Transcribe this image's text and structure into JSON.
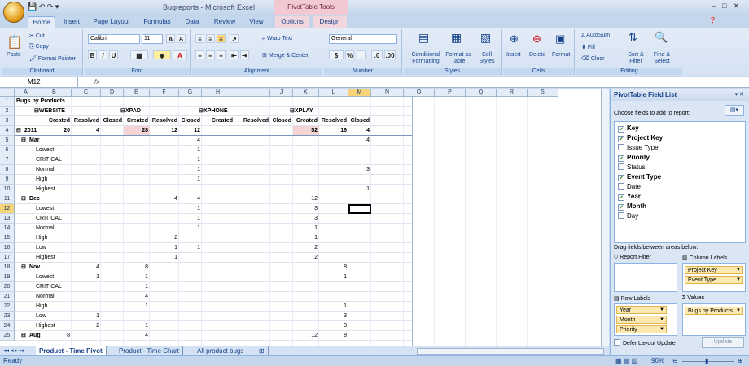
{
  "window": {
    "title": "Bugreports - Microsoft Excel",
    "context_tab_group": "PivotTable Tools"
  },
  "tabs": [
    "Home",
    "Insert",
    "Page Layout",
    "Formulas",
    "Data",
    "Review",
    "View",
    "Options",
    "Design"
  ],
  "ribbon": {
    "clipboard": {
      "label": "Clipboard",
      "paste": "Paste",
      "cut": "Cut",
      "copy": "Copy",
      "format_painter": "Format Painter"
    },
    "font": {
      "label": "Font",
      "name": "Calibri",
      "size": "11"
    },
    "alignment": {
      "label": "Alignment",
      "wrap": "Wrap Text",
      "merge": "Merge & Center"
    },
    "number": {
      "label": "Number",
      "format": "General"
    },
    "styles": {
      "label": "Styles",
      "conditional": "Conditional Formatting",
      "as_table": "Format as Table",
      "cell_styles": "Cell Styles"
    },
    "cells": {
      "label": "Cells",
      "insert": "Insert",
      "delete": "Delete",
      "format": "Format"
    },
    "editing": {
      "label": "Editing",
      "autosum": "AutoSum",
      "fill": "Fill",
      "clear": "Clear",
      "sort": "Sort & Filter",
      "find": "Find & Select"
    }
  },
  "formula_bar": {
    "name_box": "M12",
    "fx": "fx",
    "value": ""
  },
  "columns": [
    "A",
    "B",
    "C",
    "D",
    "E",
    "F",
    "G",
    "H",
    "I",
    "J",
    "K",
    "L",
    "M",
    "N",
    "O",
    "P",
    "Q",
    "R",
    "S"
  ],
  "rows": [
    "1",
    "2",
    "3",
    "4",
    "5",
    "6",
    "7",
    "8",
    "9",
    "10",
    "11",
    "12",
    "13",
    "14",
    "15",
    "16",
    "17",
    "18",
    "19",
    "20",
    "21",
    "22",
    "23",
    "24",
    "25"
  ],
  "pivot": {
    "title": "Bugs by Products",
    "products": [
      "WEBSITE",
      "XPAD",
      "XPHONE",
      "XPLAY"
    ],
    "subheaders": [
      "Created",
      "Resolved",
      "Closed"
    ],
    "rows": [
      {
        "label": "2011",
        "level": 0,
        "vals": [
          "20",
          "4",
          "",
          "28",
          "12",
          "12",
          "",
          "",
          "",
          "52",
          "16",
          "4"
        ]
      },
      {
        "label": "Mar",
        "level": 1,
        "vals": [
          "",
          "",
          "",
          "",
          "",
          "4",
          "",
          "",
          "",
          "",
          "",
          "4"
        ]
      },
      {
        "label": "Lowest",
        "level": 2,
        "vals": [
          "",
          "",
          "",
          "",
          "",
          "1",
          "",
          "",
          "",
          "",
          "",
          ""
        ]
      },
      {
        "label": "CRITICAL",
        "level": 2,
        "vals": [
          "",
          "",
          "",
          "",
          "",
          "1",
          "",
          "",
          "",
          "",
          "",
          ""
        ]
      },
      {
        "label": "Normal",
        "level": 2,
        "vals": [
          "",
          "",
          "",
          "",
          "",
          "1",
          "",
          "",
          "",
          "",
          "",
          "3"
        ]
      },
      {
        "label": "High",
        "level": 2,
        "vals": [
          "",
          "",
          "",
          "",
          "",
          "1",
          "",
          "",
          "",
          "",
          "",
          ""
        ]
      },
      {
        "label": "Highest",
        "level": 2,
        "vals": [
          "",
          "",
          "",
          "",
          "",
          "",
          "",
          "",
          "",
          "",
          "",
          "1"
        ]
      },
      {
        "label": "Dec",
        "level": 1,
        "vals": [
          "",
          "",
          "",
          "",
          "4",
          "4",
          "",
          "",
          "",
          "12",
          "",
          ""
        ]
      },
      {
        "label": "Lowest",
        "level": 2,
        "vals": [
          "",
          "",
          "",
          "",
          "",
          "1",
          "",
          "",
          "",
          "3",
          "",
          ""
        ]
      },
      {
        "label": "CRITICAL",
        "level": 2,
        "vals": [
          "",
          "",
          "",
          "",
          "",
          "1",
          "",
          "",
          "",
          "3",
          "",
          ""
        ]
      },
      {
        "label": "Normal",
        "level": 2,
        "vals": [
          "",
          "",
          "",
          "",
          "",
          "1",
          "",
          "",
          "",
          "1",
          "",
          ""
        ]
      },
      {
        "label": "High",
        "level": 2,
        "vals": [
          "",
          "",
          "",
          "",
          "2",
          "",
          "",
          "",
          "",
          "1",
          "",
          ""
        ]
      },
      {
        "label": "Low",
        "level": 2,
        "vals": [
          "",
          "",
          "",
          "",
          "1",
          "1",
          "",
          "",
          "",
          "2",
          "",
          ""
        ]
      },
      {
        "label": "Highest",
        "level": 2,
        "vals": [
          "",
          "",
          "",
          "",
          "1",
          "",
          "",
          "",
          "",
          "2",
          "",
          ""
        ]
      },
      {
        "label": "Nov",
        "level": 1,
        "vals": [
          "",
          "4",
          "",
          "8",
          "",
          "",
          "",
          "",
          "",
          "",
          "8",
          ""
        ]
      },
      {
        "label": "Lowest",
        "level": 2,
        "vals": [
          "",
          "1",
          "",
          "1",
          "",
          "",
          "",
          "",
          "",
          "",
          "1",
          ""
        ]
      },
      {
        "label": "CRITICAL",
        "level": 2,
        "vals": [
          "",
          "",
          "",
          "1",
          "",
          "",
          "",
          "",
          "",
          "",
          "",
          ""
        ]
      },
      {
        "label": "Normal",
        "level": 2,
        "vals": [
          "",
          "",
          "",
          "4",
          "",
          "",
          "",
          "",
          "",
          "",
          "",
          ""
        ]
      },
      {
        "label": "High",
        "level": 2,
        "vals": [
          "",
          "",
          "",
          "1",
          "",
          "",
          "",
          "",
          "",
          "",
          "1",
          ""
        ]
      },
      {
        "label": "Low",
        "level": 2,
        "vals": [
          "",
          "1",
          "",
          "",
          "",
          "",
          "",
          "",
          "",
          "",
          "3",
          ""
        ]
      },
      {
        "label": "Highest",
        "level": 2,
        "vals": [
          "",
          "2",
          "",
          "1",
          "",
          "",
          "",
          "",
          "",
          "",
          "3",
          ""
        ]
      },
      {
        "label": "Aug",
        "level": 1,
        "vals": [
          "8",
          "",
          "",
          "4",
          "",
          "",
          "",
          "",
          "",
          "12",
          "8",
          ""
        ]
      }
    ]
  },
  "sheet_tabs": [
    "Product - Time Pivot",
    "Product - Time Chart",
    "All product bugs"
  ],
  "status": {
    "ready": "Ready",
    "zoom": "90%"
  },
  "field_list": {
    "title": "PivotTable Field List",
    "choose_label": "Choose fields to add to report:",
    "fields": [
      {
        "name": "Key",
        "checked": true
      },
      {
        "name": "Project Key",
        "checked": true
      },
      {
        "name": "Issue Type",
        "checked": false
      },
      {
        "name": "Priority",
        "checked": true
      },
      {
        "name": "Status",
        "checked": false
      },
      {
        "name": "Event Type",
        "checked": true
      },
      {
        "name": "Date",
        "checked": false
      },
      {
        "name": "Year",
        "checked": true
      },
      {
        "name": "Month",
        "checked": true
      },
      {
        "name": "Day",
        "checked": false
      }
    ],
    "drag_label": "Drag fields between areas below:",
    "report_filter": "Report Filter",
    "column_labels": "Column Labels",
    "row_labels": "Row Labels",
    "values": "Values",
    "column_fields": [
      "Project Key",
      "Event Type"
    ],
    "row_fields": [
      "Year",
      "Month",
      "Priority"
    ],
    "value_fields": [
      "Bugs by Products"
    ],
    "defer_label": "Defer Layout Update",
    "update_label": "Update"
  }
}
